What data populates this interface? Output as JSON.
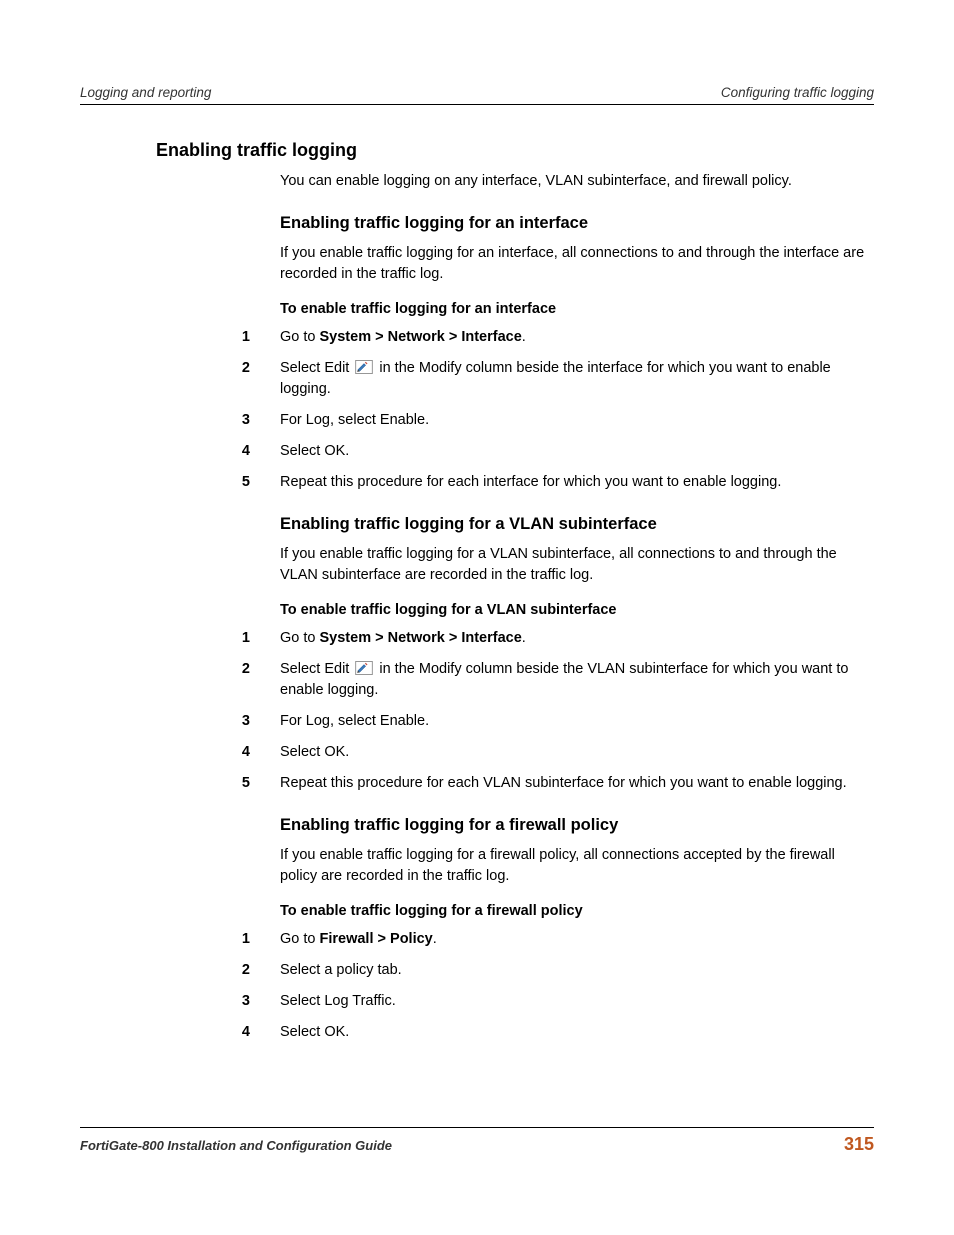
{
  "header": {
    "left": "Logging and reporting",
    "right": "Configuring traffic logging"
  },
  "main": {
    "h1": "Enabling traffic logging",
    "intro": "You can enable logging on any interface, VLAN subinterface, and firewall policy.",
    "sections": [
      {
        "h2": "Enabling traffic logging for an interface",
        "para": "If you enable traffic logging for an interface, all connections to and through the interface are recorded in the traffic log.",
        "h3": "To enable traffic logging for an interface",
        "steps": [
          {
            "n": "1",
            "pre": "Go to ",
            "bold": "System > Network > Interface",
            "post": "."
          },
          {
            "n": "2",
            "pre": "Select Edit ",
            "icon": true,
            "post": " in the Modify column beside the interface for which you want to enable logging."
          },
          {
            "n": "3",
            "pre": "For Log, select Enable."
          },
          {
            "n": "4",
            "pre": "Select OK."
          },
          {
            "n": "5",
            "pre": "Repeat this procedure for each interface for which you want to enable logging."
          }
        ]
      },
      {
        "h2": "Enabling traffic logging for a VLAN subinterface",
        "para": "If you enable traffic logging for a VLAN subinterface, all connections to and through the VLAN subinterface are recorded in the traffic log.",
        "h3": "To enable traffic logging for a VLAN subinterface",
        "steps": [
          {
            "n": "1",
            "pre": "Go to ",
            "bold": "System > Network > Interface",
            "post": "."
          },
          {
            "n": "2",
            "pre": "Select Edit ",
            "icon": true,
            "post": " in the Modify column beside the VLAN subinterface for which you want to enable logging."
          },
          {
            "n": "3",
            "pre": "For Log, select Enable."
          },
          {
            "n": "4",
            "pre": "Select OK."
          },
          {
            "n": "5",
            "pre": "Repeat this procedure for each VLAN subinterface for which you want to enable logging."
          }
        ]
      },
      {
        "h2": "Enabling traffic logging for a firewall policy",
        "para": "If you enable traffic logging for a firewall policy, all connections accepted by the firewall policy are recorded in the traffic log.",
        "h3": "To enable traffic logging for a firewall policy",
        "steps": [
          {
            "n": "1",
            "pre": "Go to ",
            "bold": "Firewall > Policy",
            "post": "."
          },
          {
            "n": "2",
            "pre": "Select a policy tab."
          },
          {
            "n": "3",
            "pre": "Select Log Traffic."
          },
          {
            "n": "4",
            "pre": "Select OK."
          }
        ]
      }
    ]
  },
  "footer": {
    "left": "FortiGate-800 Installation and Configuration Guide",
    "page": "315"
  }
}
